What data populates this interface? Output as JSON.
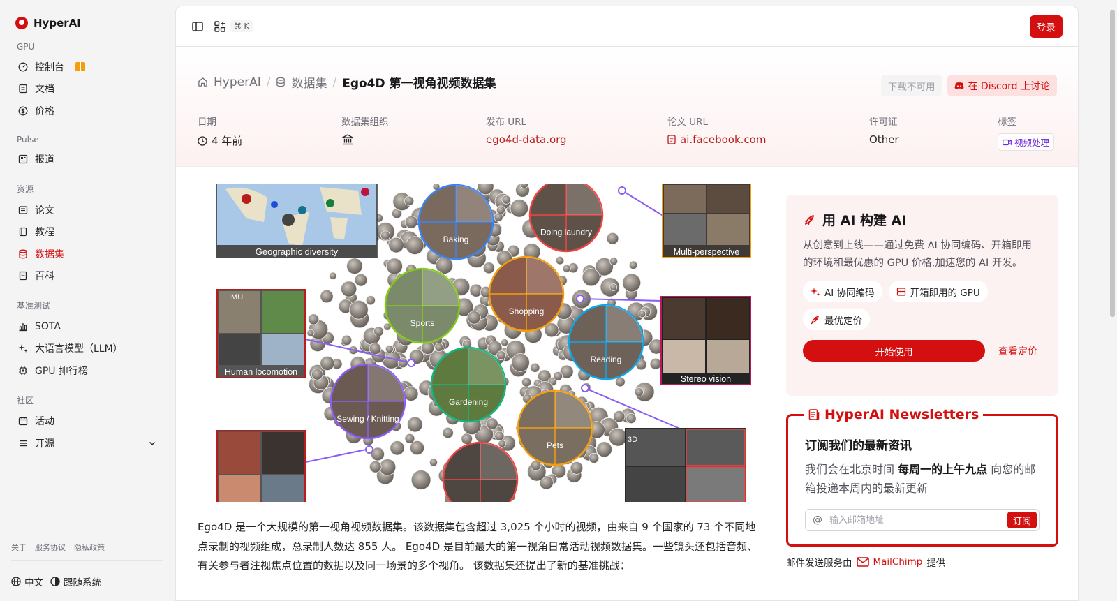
{
  "brand": {
    "name": "HyperAI"
  },
  "sidebar": {
    "sections": [
      {
        "title": "GPU",
        "items": [
          {
            "label": "控制台",
            "icon": "dashboard-icon"
          },
          {
            "label": "文档",
            "icon": "document-icon"
          },
          {
            "label": "价格",
            "icon": "dollar-icon"
          }
        ]
      },
      {
        "title": "Pulse",
        "items": [
          {
            "label": "报道",
            "icon": "news-icon"
          }
        ]
      },
      {
        "title": "资源",
        "items": [
          {
            "label": "论文",
            "icon": "paper-icon"
          },
          {
            "label": "教程",
            "icon": "book-icon"
          },
          {
            "label": "数据集",
            "icon": "database-icon",
            "active": true
          },
          {
            "label": "百科",
            "icon": "encyclopedia-icon"
          }
        ]
      },
      {
        "title": "基准测试",
        "items": [
          {
            "label": "SOTA",
            "icon": "bar-chart-icon"
          },
          {
            "label": "大语言模型（LLM）",
            "icon": "sparkle-icon"
          },
          {
            "label": "GPU 排行榜",
            "icon": "chip-icon"
          }
        ]
      },
      {
        "title": "社区",
        "items": [
          {
            "label": "活动",
            "icon": "calendar-icon"
          },
          {
            "label": "开源",
            "icon": "list-icon",
            "expandable": true
          }
        ]
      }
    ],
    "footer_links": [
      "关于",
      "服务协议",
      "隐私政策"
    ],
    "language": "中文",
    "theme": "跟随系统"
  },
  "topbar": {
    "shortcut": "⌘ K",
    "login": "登录"
  },
  "breadcrumb": {
    "home": "HyperAI",
    "section": "数据集",
    "current": "Ego4D 第一视角视频数据集"
  },
  "actions": {
    "download": "下载不可用",
    "discord": "在 Discord 上讨论"
  },
  "meta": {
    "date": {
      "label": "日期",
      "value": "4 年前"
    },
    "org": {
      "label": "数据集组织"
    },
    "url": {
      "label": "发布 URL",
      "value": "ego4d-data.org"
    },
    "paper": {
      "label": "论文 URL",
      "value": "ai.facebook.com"
    },
    "license": {
      "label": "许可证",
      "value": "Other"
    },
    "tags": {
      "label": "标签",
      "value": "视频处理"
    }
  },
  "hero": {
    "captions": [
      "Geographic diversity",
      "Baking",
      "Doing laundry",
      "Multi-perspective",
      "IMU",
      "Human locomotion",
      "Sports",
      "Shopping",
      "Reading",
      "Stereo vision",
      "Gardening",
      "Sewing / Knitting",
      "Pets",
      "3D"
    ]
  },
  "description": "Ego4D 是一个大规模的第一视角视频数据集。该数据集包含超过 3,025 个小时的视频，由来自 9 个国家的 73 个不同地点录制的视频组成，总录制人数达 855 人。 Ego4D 是目前最大的第一视角日常活动视频数据集。一些镜头还包括音频、有关参与者注视焦点位置的数据以及同一场景的多个视角。 该数据集还提出了新的基准挑战：",
  "promo": {
    "title": "用 AI 构建 AI",
    "text": "从创意到上线——通过免费 AI 协同编码、开箱即用的环境和最优惠的 GPU 价格,加速您的 AI 开发。",
    "chips": [
      "AI 协同编码",
      "开箱即用的 GPU",
      "最优定价"
    ],
    "start": "开始使用",
    "pricing": "查看定价"
  },
  "newsletter": {
    "legend": "HyperAI Newsletters",
    "title": "订阅我们的最新资讯",
    "text_pre": "我们会在北京时间 ",
    "text_bold": "每周一的上午九点",
    "text_post": " 向您的邮箱投递本周内的最新更新",
    "placeholder": "输入邮箱地址",
    "subscribe": "订阅",
    "note_pre": "邮件发送服务由",
    "note_brand": "MailChimp",
    "note_post": "提供"
  },
  "colors": {
    "accent": "#d40f0f",
    "tag": "#6d28d9"
  }
}
